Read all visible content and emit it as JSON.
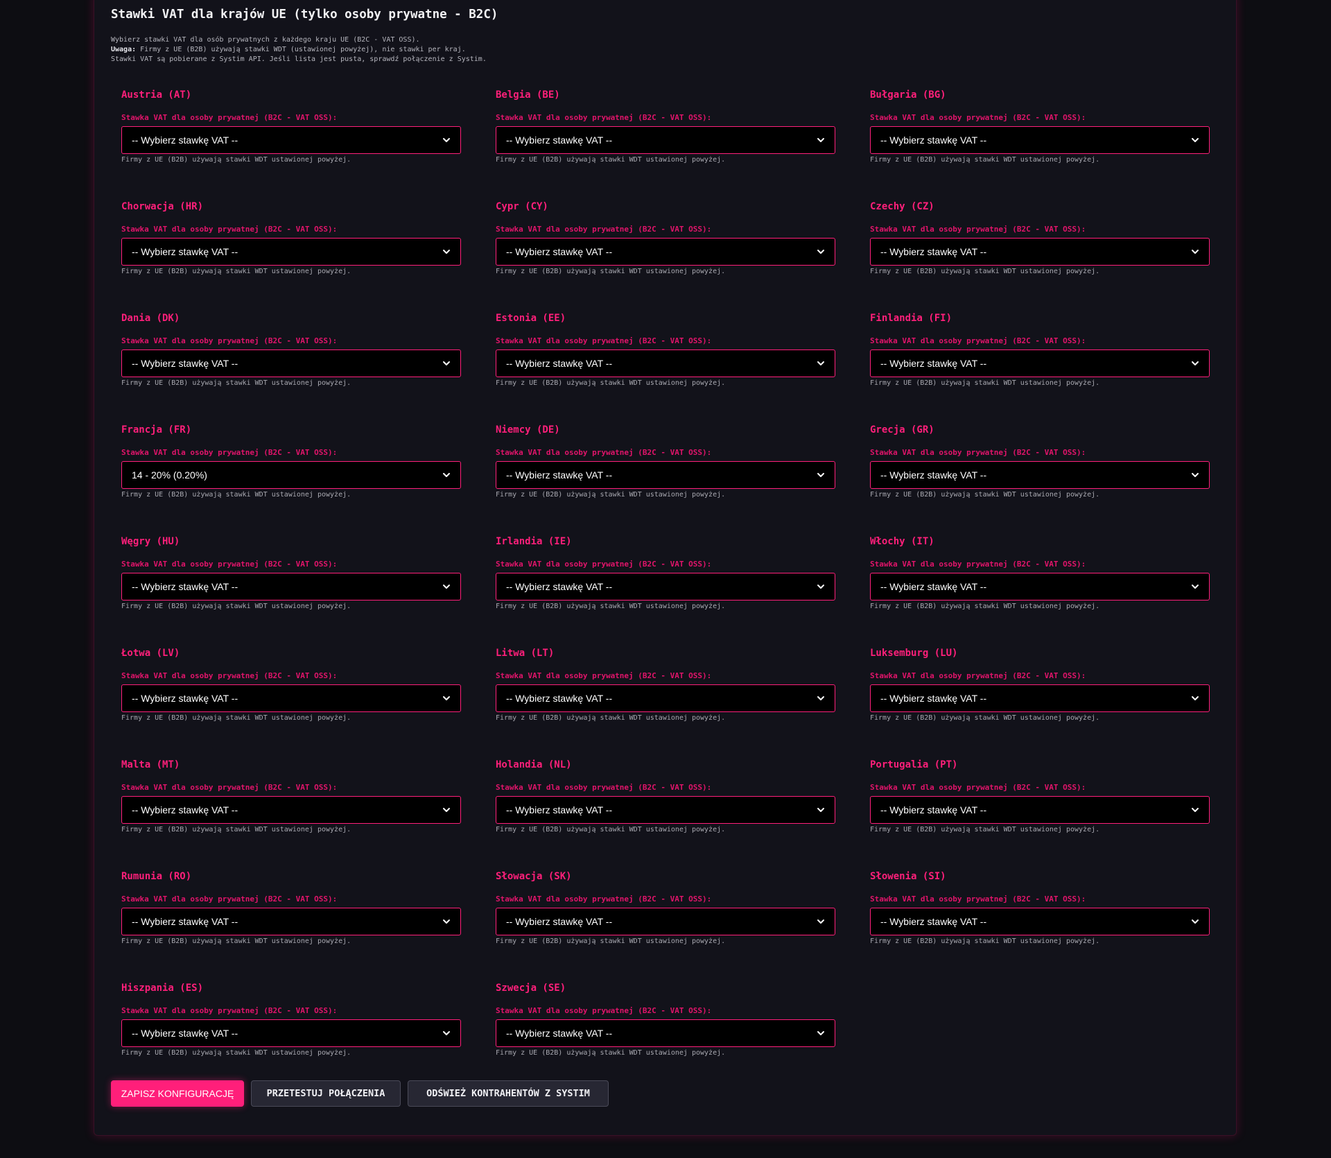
{
  "section": {
    "title": "Stawki VAT dla krajów UE (tylko osoby prywatne - B2C)",
    "intro_line1": "Wybierz stawki VAT dla osób prywatnych z każdego kraju UE (B2C - VAT OSS).",
    "intro_note_label": "Uwaga:",
    "intro_line2": " Firmy z UE (B2B) używają stawki WDT (ustawionej powyżej), nie stawki per kraj.",
    "intro_line3": "Stawki VAT są pobierane z Systim API. Jeśli lista jest pusta, sprawdź połączenie z Systim."
  },
  "field_label": "Stawka VAT dla osoby prywatnej (B2C - VAT OSS):",
  "hint_text": "Firmy z UE (B2B) używają stawki WDT ustawionej powyżej.",
  "countries": [
    {
      "name": "Austria (AT)",
      "selected": "-- Wybierz stawkę VAT --"
    },
    {
      "name": "Belgia (BE)",
      "selected": "-- Wybierz stawkę VAT --"
    },
    {
      "name": "Bułgaria (BG)",
      "selected": "-- Wybierz stawkę VAT --"
    },
    {
      "name": "Chorwacja (HR)",
      "selected": "-- Wybierz stawkę VAT --"
    },
    {
      "name": "Cypr (CY)",
      "selected": "-- Wybierz stawkę VAT --"
    },
    {
      "name": "Czechy (CZ)",
      "selected": "-- Wybierz stawkę VAT --"
    },
    {
      "name": "Dania (DK)",
      "selected": "-- Wybierz stawkę VAT --"
    },
    {
      "name": "Estonia (EE)",
      "selected": "-- Wybierz stawkę VAT --"
    },
    {
      "name": "Finlandia (FI)",
      "selected": "-- Wybierz stawkę VAT --"
    },
    {
      "name": "Francja (FR)",
      "selected": "14 - 20% (0.20%)"
    },
    {
      "name": "Niemcy (DE)",
      "selected": "-- Wybierz stawkę VAT --"
    },
    {
      "name": "Grecja (GR)",
      "selected": "-- Wybierz stawkę VAT --"
    },
    {
      "name": "Węgry (HU)",
      "selected": "-- Wybierz stawkę VAT --"
    },
    {
      "name": "Irlandia (IE)",
      "selected": "-- Wybierz stawkę VAT --"
    },
    {
      "name": "Włochy (IT)",
      "selected": "-- Wybierz stawkę VAT --"
    },
    {
      "name": "Łotwa (LV)",
      "selected": "-- Wybierz stawkę VAT --"
    },
    {
      "name": "Litwa (LT)",
      "selected": "-- Wybierz stawkę VAT --"
    },
    {
      "name": "Luksemburg (LU)",
      "selected": "-- Wybierz stawkę VAT --"
    },
    {
      "name": "Malta (MT)",
      "selected": "-- Wybierz stawkę VAT --"
    },
    {
      "name": "Holandia (NL)",
      "selected": "-- Wybierz stawkę VAT --"
    },
    {
      "name": "Portugalia (PT)",
      "selected": "-- Wybierz stawkę VAT --"
    },
    {
      "name": "Rumunia (RO)",
      "selected": "-- Wybierz stawkę VAT --"
    },
    {
      "name": "Słowacja (SK)",
      "selected": "-- Wybierz stawkę VAT --"
    },
    {
      "name": "Słowenia (SI)",
      "selected": "-- Wybierz stawkę VAT --"
    },
    {
      "name": "Hiszpania (ES)",
      "selected": "-- Wybierz stawkę VAT --"
    },
    {
      "name": "Szwecja (SE)",
      "selected": "-- Wybierz stawkę VAT --"
    }
  ],
  "actions": {
    "save_label": "ZAPISZ KONFIGURACJĘ",
    "test_label": "PRZETESTUJ POŁĄCZENIA",
    "refresh_label": "ODŚWIEŻ KONTRAHENTÓW Z SYSTIM"
  },
  "icons": {
    "select_chevron": "chevron-down-icon"
  },
  "colors": {
    "accent": "#ff1f7a",
    "background": "#0d0d12",
    "panel": "#12121a",
    "select_background": "#000000",
    "text": "#ffffff",
    "muted_text": "#a8a8b0",
    "secondary_button": "#272733"
  }
}
